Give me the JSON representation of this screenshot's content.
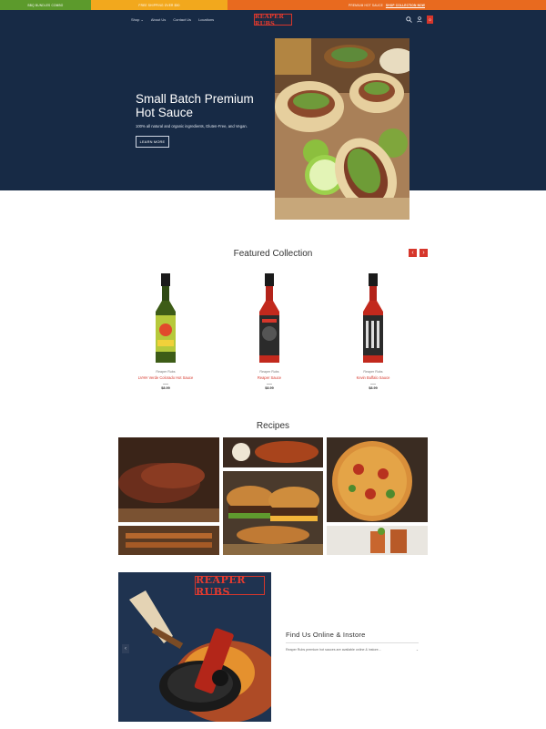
{
  "topbar": {
    "segment1": "BBQ Bundles Combo",
    "segment2": "Free Shipping over $50",
    "segment3_text": "Premium Hot Sauce",
    "segment3_link": "Shop Collection Now"
  },
  "nav": {
    "items": [
      "Shop ⌄",
      "About Us",
      "Contact Us",
      "Locations"
    ],
    "logo": "REAPER RUBS",
    "cart_count": "0"
  },
  "hero": {
    "title": "Small Batch Premium Hot Sauce",
    "subtitle": "100% all natural and organic ingredients, Gluten-Free, and Vegan.",
    "button": "LEARN MORE"
  },
  "featured": {
    "title": "Featured Collection",
    "prev": "‹",
    "next": "›",
    "products": [
      {
        "brand": "Reaper Rubs",
        "name": "LVHH Verde Colorado Hot Sauce",
        "price": "$8.99",
        "label_color": "#b6c93b"
      },
      {
        "brand": "Reaper Rubs",
        "name": "Reaper Sauce",
        "price": "$8.99",
        "label_color": "#2b2b2b"
      },
      {
        "brand": "Reaper Rubs",
        "name": "Kevin Buffalo Sauce",
        "price": "$8.99",
        "label_color": "#2b2b2b"
      }
    ]
  },
  "recipes": {
    "title": "Recipes"
  },
  "find": {
    "title": "Find Us Online & Instore",
    "text": "Reaper Rubs premium hot sauces are available online & instore...",
    "chevron": "⌄"
  },
  "promo": {
    "logo": "REAPER RUBS",
    "arrow": "‹"
  },
  "colors": {
    "navy": "#172a45",
    "accent_red": "#d6362b"
  }
}
